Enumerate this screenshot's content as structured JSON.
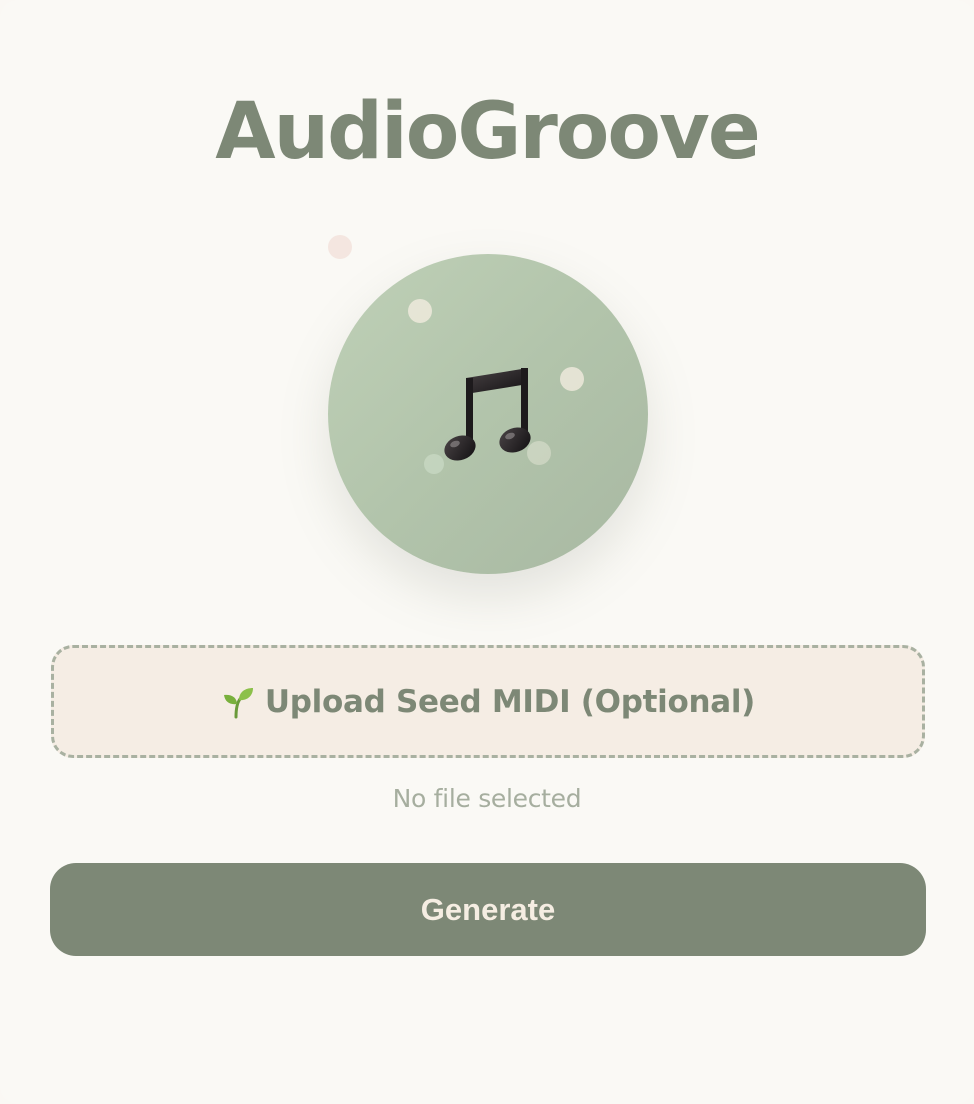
{
  "app": {
    "title": "AudioGroove"
  },
  "visual": {
    "center_icon": "music-note-icon",
    "accent_color": "#7d8876",
    "disc_color": "#b5c6ad"
  },
  "upload": {
    "icon": "sprout-icon",
    "label": "Upload Seed MIDI (Optional)"
  },
  "file_status": "No file selected",
  "actions": {
    "generate_label": "Generate"
  }
}
